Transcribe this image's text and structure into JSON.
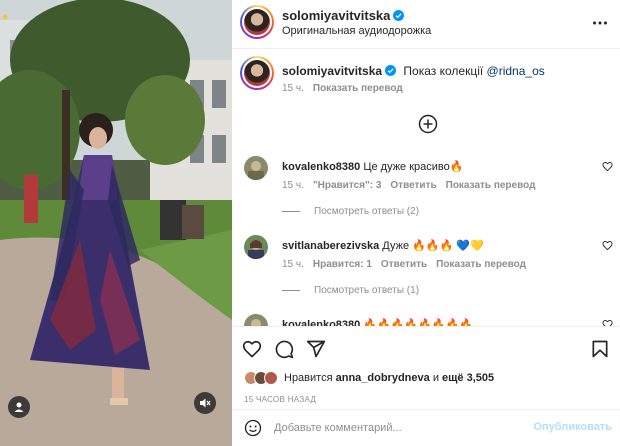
{
  "post": {
    "author": "solomiyavitvitska",
    "audio": "Оригинальная аудиодорожка",
    "caption_text": "Показ колекції",
    "caption_mention": "@ridna_os",
    "caption_time": "15 ч.",
    "translate_label": "Показать перевод",
    "more_icon": "more-dots-icon",
    "load_more_icon": "plus-circle-icon"
  },
  "comments": [
    {
      "username": "kovalenko8380",
      "text": "Це дуже красиво",
      "emoji": "🔥",
      "time": "15 ч.",
      "likes": "\"Нравится\": 3",
      "reply": "Ответить",
      "translate": "Показать перевод",
      "replies": "Посмотреть ответы (2)"
    },
    {
      "username": "svitlanaberezivska",
      "text": "Дуже",
      "emoji": "🔥🔥🔥 💙💛",
      "time": "15 ч.",
      "likes": "Нравится: 1",
      "reply": "Ответить",
      "translate": "Показать перевод",
      "replies": "Посмотреть ответы (1)"
    },
    {
      "username": "kovalenko8380",
      "text": "",
      "emoji": "🔥🔥🔥🔥🔥🔥🔥🔥"
    }
  ],
  "footer": {
    "likes_prefix": "Нравится",
    "likes_user": "anna_dobrydneva",
    "likes_and": "и",
    "likes_more": "ещё 3,505",
    "time_ago": "15 ЧАСОВ НАЗАД",
    "comment_placeholder": "Добавьте комментарий...",
    "post_button": "Опубликовать"
  },
  "icons": [
    "heart-icon",
    "comment-icon",
    "share-icon",
    "bookmark-icon",
    "smile-icon",
    "muted-speaker-icon",
    "verified-badge-icon"
  ],
  "colors": {
    "verified": "#0095f6",
    "link": "#00376b",
    "muted_text": "#8e8e8e",
    "post_button_disabled": "#b2dffc",
    "dress": "#3a2f6b"
  }
}
